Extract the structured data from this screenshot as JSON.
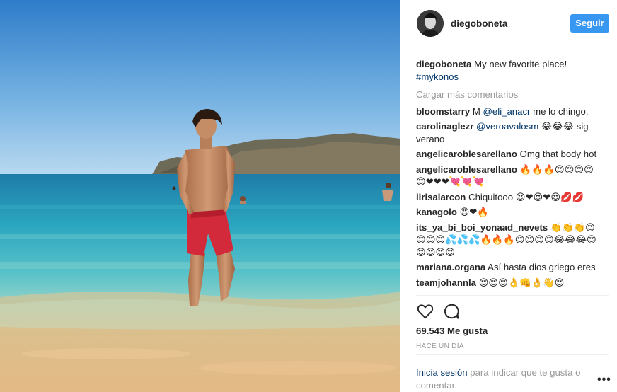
{
  "post": {
    "username": "diegoboneta",
    "follow_label": "Seguir",
    "caption": {
      "user": "diegoboneta",
      "text": "My new favorite place!",
      "hashtag": "#mykonos"
    },
    "load_more": "Cargar más comentarios",
    "comments": [
      {
        "user": "bloomstarry",
        "before": "M ",
        "mention": "@eli_anacr",
        "after": " me lo chingo."
      },
      {
        "user": "carolinaglezr",
        "before": "",
        "mention": "@veroavalosm",
        "after": " 😂😂😂 sig verano"
      },
      {
        "user": "angelicaroblesarellano",
        "before": "Omg that body hot",
        "mention": "",
        "after": ""
      },
      {
        "user": "angelicaroblesarellano",
        "before": "🔥🔥🔥😍😍😍😍😍❤❤❤💘💘💘",
        "mention": "",
        "after": ""
      },
      {
        "user": "iirisalarcon",
        "before": "Chiquitooo 😍❤😍❤😍💋💋",
        "mention": "",
        "after": ""
      },
      {
        "user": "kanagolo",
        "before": "😍❤🔥",
        "mention": "",
        "after": ""
      },
      {
        "user": "its_ya_bi_boi_yonaad_nevets",
        "before": "👏👏👏😍😍😍😍💦💦💦🔥🔥🔥😍😍😍😍😂😂😂😍😍😍😍😍",
        "mention": "",
        "after": ""
      },
      {
        "user": "mariana.organa",
        "before": "Así hasta dios griego eres",
        "mention": "",
        "after": ""
      },
      {
        "user": "teamjohannla",
        "before": "😍😍😍👌👊👌👋😍",
        "mention": "",
        "after": ""
      }
    ],
    "likes": "69.543 Me gusta",
    "time_ago": "HACE UN DÍA",
    "footer": {
      "login_link": "Inicia sesión",
      "rest": " para indicar que te gusta o comentar."
    },
    "more_options": "•••",
    "icons": {
      "like": "heart-icon",
      "comment": "comment-bubble-icon",
      "options": "ellipsis-icon"
    }
  }
}
